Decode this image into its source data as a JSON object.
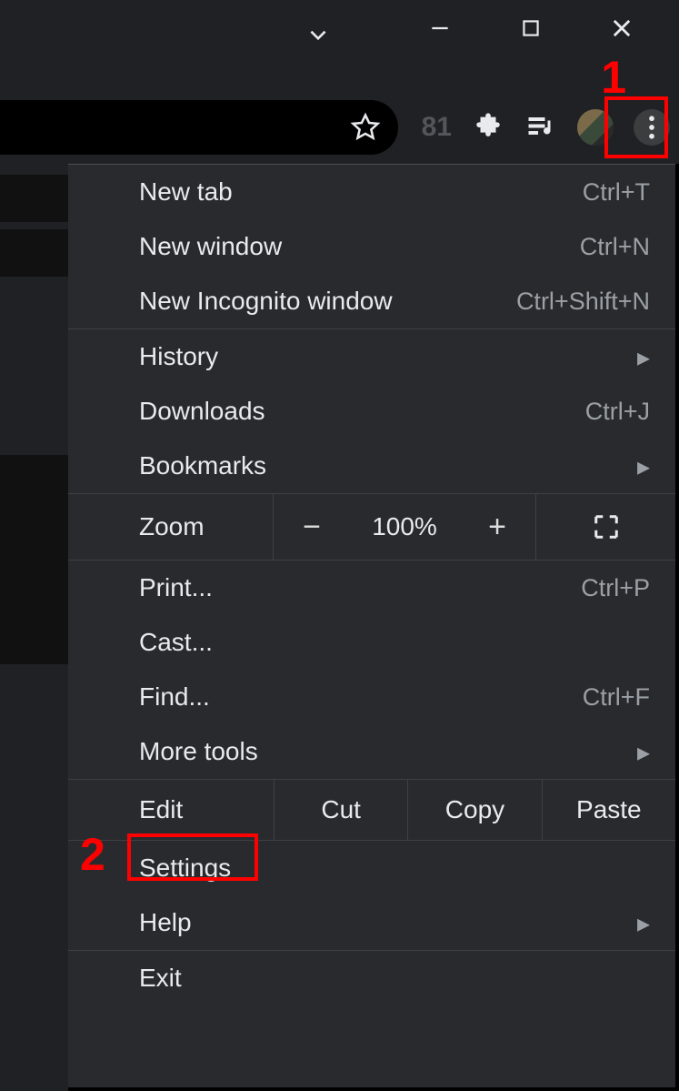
{
  "window": {
    "caption_buttons": {
      "chevron": "v",
      "minimize": "—",
      "maximize": "▢",
      "close": "✕"
    }
  },
  "toolbar": {
    "extension_count": "81"
  },
  "annotations": {
    "one": "1",
    "two": "2"
  },
  "menu": {
    "new_tab": {
      "label": "New tab",
      "shortcut": "Ctrl+T"
    },
    "new_window": {
      "label": "New window",
      "shortcut": "Ctrl+N"
    },
    "new_incognito": {
      "label": "New Incognito window",
      "shortcut": "Ctrl+Shift+N"
    },
    "history": {
      "label": "History"
    },
    "downloads": {
      "label": "Downloads",
      "shortcut": "Ctrl+J"
    },
    "bookmarks": {
      "label": "Bookmarks"
    },
    "zoom": {
      "label": "Zoom",
      "minus": "−",
      "percent": "100%",
      "plus": "+"
    },
    "print": {
      "label": "Print...",
      "shortcut": "Ctrl+P"
    },
    "cast": {
      "label": "Cast..."
    },
    "find": {
      "label": "Find...",
      "shortcut": "Ctrl+F"
    },
    "more_tools": {
      "label": "More tools"
    },
    "edit": {
      "label": "Edit",
      "cut": "Cut",
      "copy": "Copy",
      "paste": "Paste"
    },
    "settings": {
      "label": "Settings"
    },
    "help": {
      "label": "Help"
    },
    "exit": {
      "label": "Exit"
    }
  }
}
